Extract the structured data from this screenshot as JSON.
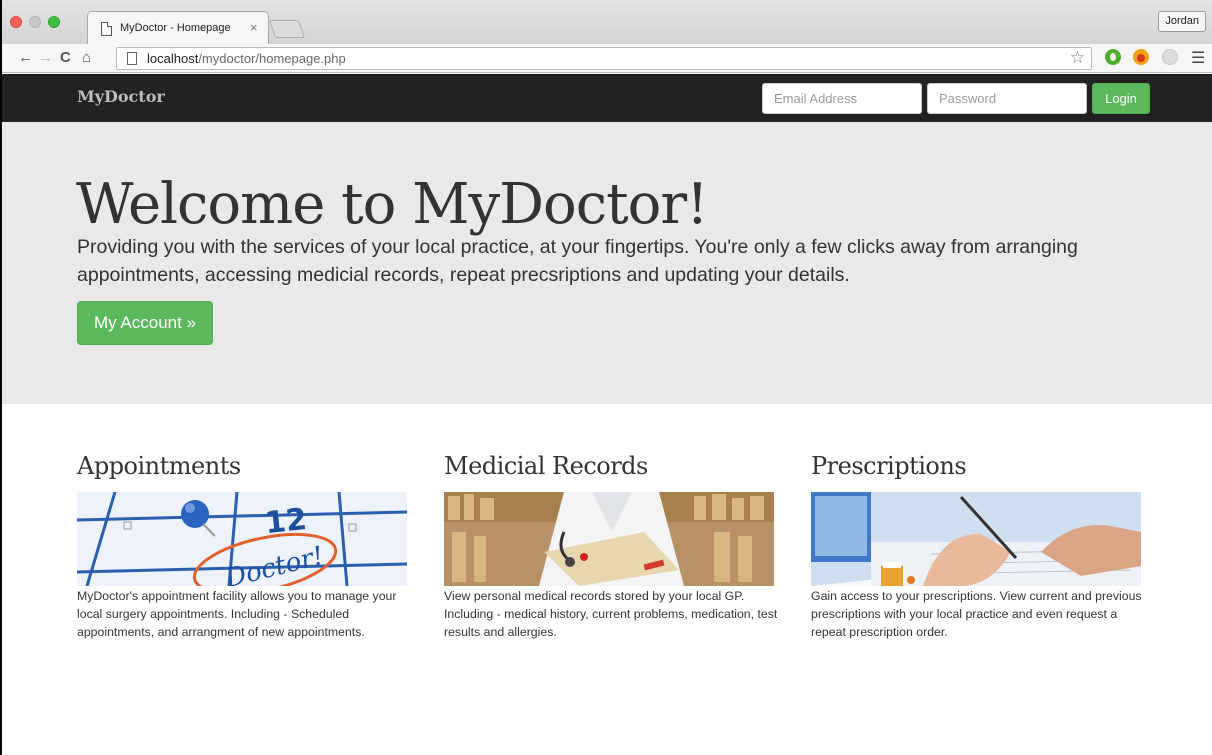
{
  "browser": {
    "tab_title": "MyDoctor - Homepage",
    "tab_close": "×",
    "profile_name": "Jordan",
    "url_host": "localhost",
    "url_path": "/mydoctor/homepage.php",
    "icons": [
      "back-arrow-icon",
      "forward-arrow-icon",
      "reload-icon",
      "home-icon",
      "page-icon",
      "star-icon",
      "menu-icon"
    ]
  },
  "navbar": {
    "brand": "MyDoctor",
    "email_placeholder": "Email Address",
    "password_placeholder": "Password",
    "login_label": "Login"
  },
  "jumbotron": {
    "title": "Welcome to MyDoctor!",
    "lead": "Providing you with the services of your local practice, at your fingertips. You're only a few clicks away from arranging appointments, accessing medicial records, repeat precsriptions and updating your details.",
    "button_label": "My Account »"
  },
  "features": [
    {
      "title": "Appointments",
      "image_caption": "Doctor!",
      "image_number": "12",
      "text": "MyDoctor's appointment facility allows you to manage your local surgery appointments. Including - Scheduled appointments, and arrangment of new appointments."
    },
    {
      "title": "Medicial Records",
      "text": "View personal medical records stored by your local GP. Including - medical history, current problems, medication, test results and allergies."
    },
    {
      "title": "Prescriptions",
      "text": "Gain access to your prescriptions. View current and previous prescriptions with your local practice and even request a repeat prescription order."
    }
  ],
  "colors": {
    "navbar_bg": "#222222",
    "jumbotron_bg": "#e9e9e9",
    "success_green": "#5cb85c"
  }
}
